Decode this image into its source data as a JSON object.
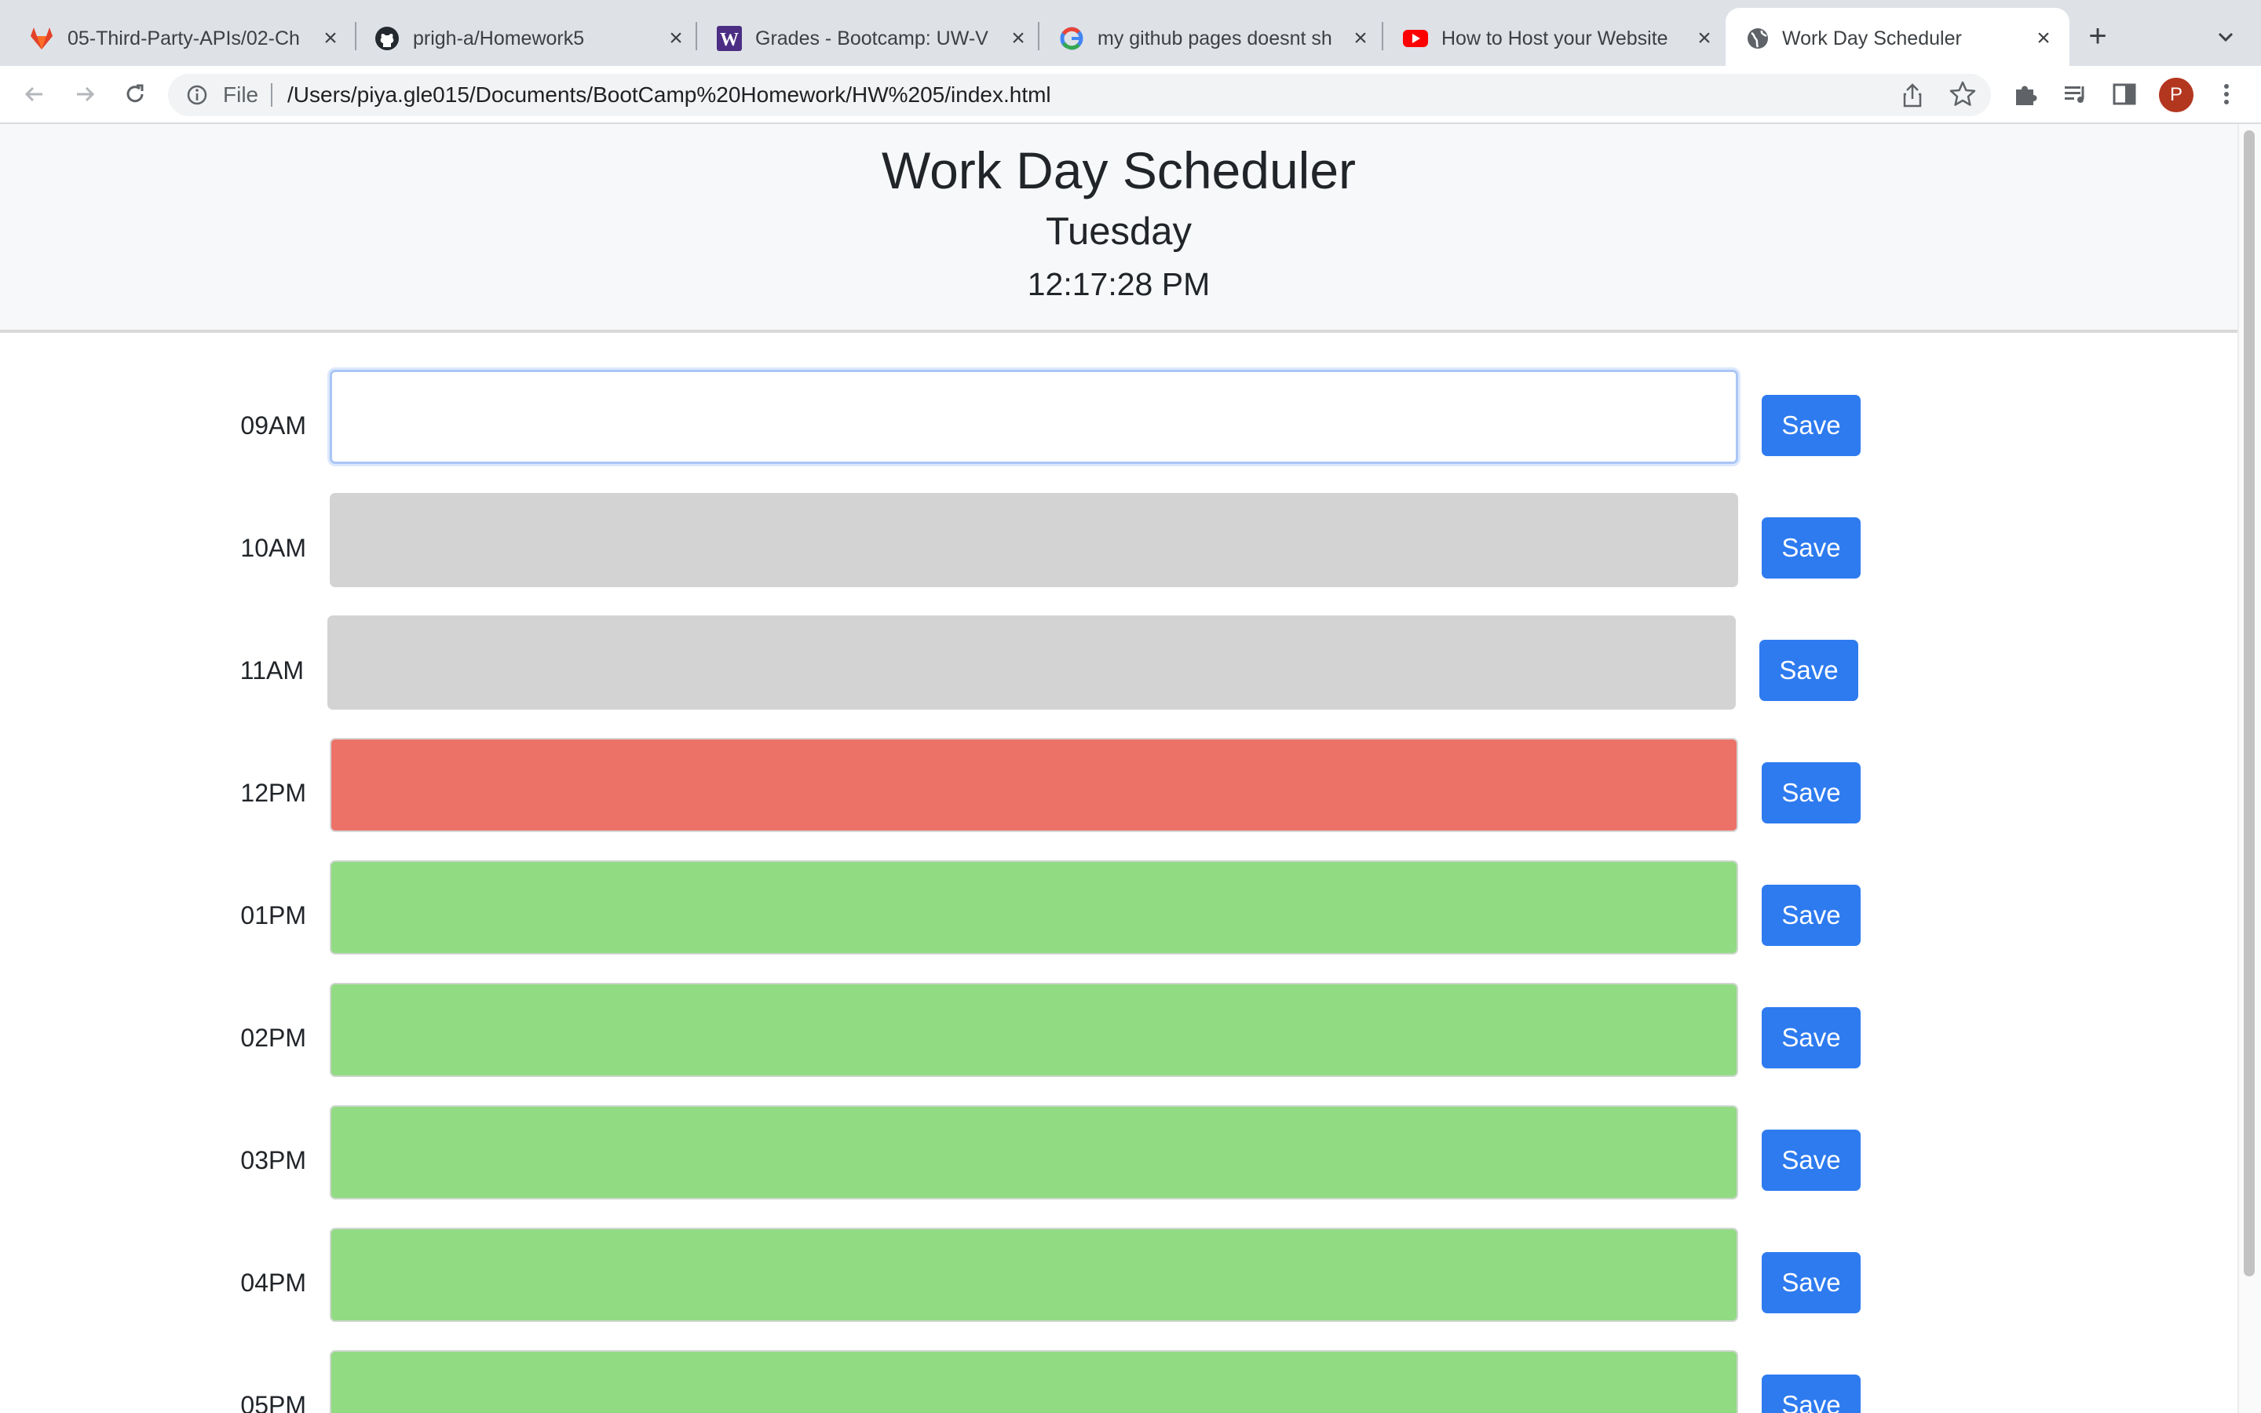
{
  "browser": {
    "tabs": [
      {
        "title": "05-Third-Party-APIs/02-Ch",
        "icon": "gitlab-icon"
      },
      {
        "title": "prigh-a/Homework5",
        "icon": "github-icon"
      },
      {
        "title": "Grades - Bootcamp: UW-V",
        "icon": "canvas-w-icon"
      },
      {
        "title": "my github pages doesnt sh",
        "icon": "google-icon"
      },
      {
        "title": "How to Host your Website",
        "icon": "youtube-icon"
      },
      {
        "title": "Work Day Scheduler",
        "icon": "globe-icon",
        "active": true
      }
    ],
    "new_tab_label": "+",
    "close_glyph": "×",
    "omnibox": {
      "file_label": "File",
      "url": "/Users/piya.gle015/Documents/BootCamp%20Homework/HW%205/index.html"
    },
    "profile_initial": "P",
    "profile_color": "#b3361f"
  },
  "header": {
    "title": "Work Day Scheduler",
    "day": "Tuesday",
    "time": "12:17:28 PM"
  },
  "schedule": {
    "rows": [
      {
        "hour": "09AM",
        "status": "focused",
        "text": "",
        "save_label": "Save"
      },
      {
        "hour": "10AM",
        "status": "past",
        "text": "",
        "save_label": "Save"
      },
      {
        "hour": "11AM",
        "status": "past",
        "text": "",
        "save_label": "Save"
      },
      {
        "hour": "12PM",
        "status": "present",
        "text": "",
        "save_label": "Save"
      },
      {
        "hour": "01PM",
        "status": "future",
        "text": "",
        "save_label": "Save"
      },
      {
        "hour": "02PM",
        "status": "future",
        "text": "",
        "save_label": "Save"
      },
      {
        "hour": "03PM",
        "status": "future",
        "text": "",
        "save_label": "Save"
      },
      {
        "hour": "04PM",
        "status": "future",
        "text": "",
        "save_label": "Save"
      },
      {
        "hour": "05PM",
        "status": "future",
        "text": "",
        "save_label": "Save"
      }
    ]
  },
  "colors": {
    "past": "#d3d3d3",
    "present": "#ec7268",
    "future": "#91db83",
    "save_button": "#2e7bf0"
  }
}
